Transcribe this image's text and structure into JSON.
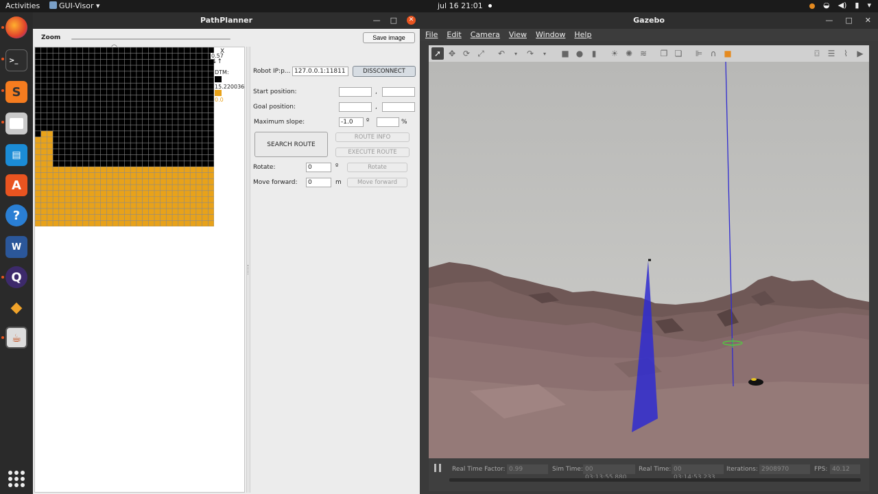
{
  "topbar": {
    "activities": "Activities",
    "app_name": "GUI-Visor",
    "clock": "jul 16  21:01"
  },
  "dock": {
    "items": [
      "firefox-icon",
      "terminal-icon",
      "sublime-icon",
      "files-icon",
      "writer-icon",
      "software-center-icon",
      "help-icon",
      "word-icon",
      "qt-icon",
      "stack-icon",
      "java-icon"
    ]
  },
  "pathplanner": {
    "title": "PathPlanner",
    "zoom_label": "Zoom",
    "zoom_level": 0.26,
    "save_image_label": "Save image",
    "colorbar": {
      "max_label": "0.57",
      "x_label": "X",
      "dtm_label": "DTM:",
      "max_value": "15.220036",
      "min_value": "0.0",
      "high_color": "#000000",
      "low_color": "#e8a21a"
    },
    "robot_ip_label": "Robot IP:p...",
    "robot_ip_value": "127.0.0.1:11811",
    "disconnect_label": "DISSCONNECT",
    "start_position_label": "Start position:",
    "goal_position_label": "Goal position:",
    "coord_separator": ",",
    "max_slope_label": "Maximum slope:",
    "max_slope_value": "-1.0",
    "degree_unit": "º",
    "percent_value": "",
    "percent_unit": "%",
    "search_route_label": "SEARCH ROUTE",
    "route_info_label": "ROUTE INFO",
    "execute_route_label": "EXECUTE ROUTE",
    "rotate_label": "Rotate:",
    "rotate_value": "0",
    "rotate_unit": "º",
    "rotate_button": "Rotate",
    "move_forward_label": "Move forward:",
    "move_forward_value": "0",
    "move_unit": "m",
    "move_forward_button": "Move forward"
  },
  "gazebo": {
    "title": "Gazebo",
    "menu": [
      "File",
      "Edit",
      "Camera",
      "View",
      "Window",
      "Help"
    ],
    "status": {
      "real_time_factor_label": "Real Time Factor:",
      "real_time_factor": "0.99",
      "sim_time_label": "Sim Time:",
      "sim_time": "00 03:13:55.880",
      "real_time_label": "Real Time:",
      "real_time": "00 03:14:53.233",
      "iterations_label": "Iterations:",
      "iterations": "2908970",
      "fps_label": "FPS:",
      "fps": "40.12"
    }
  }
}
